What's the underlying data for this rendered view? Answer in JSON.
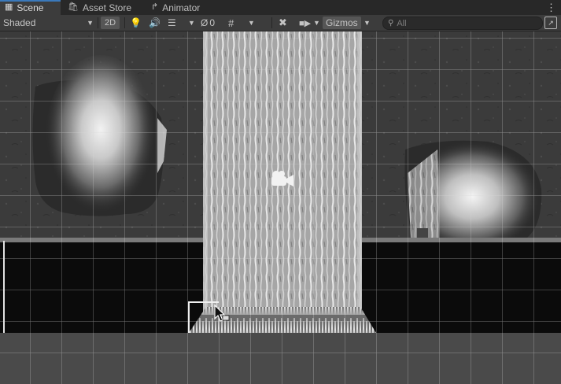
{
  "tabs": [
    {
      "label": "Scene",
      "icon": "grid-icon",
      "active": true
    },
    {
      "label": "Asset Store",
      "icon": "bag-icon",
      "active": false
    },
    {
      "label": "Animator",
      "icon": "animator-icon",
      "active": false
    }
  ],
  "toolbar": {
    "shading_mode": "Shaded",
    "mode_2d_label": "2D",
    "hidden_objects_count": "0",
    "gizmos_label": "Gizmos",
    "search_placeholder": "All"
  },
  "colors": {
    "accent": "#3a79bb",
    "panel": "#3c3c3c",
    "tab_bar": "#282828",
    "grid": "#d6d6d6"
  },
  "scene": {
    "camera_icon": "camera-icon",
    "cursor": "pointer-cursor-icon"
  }
}
